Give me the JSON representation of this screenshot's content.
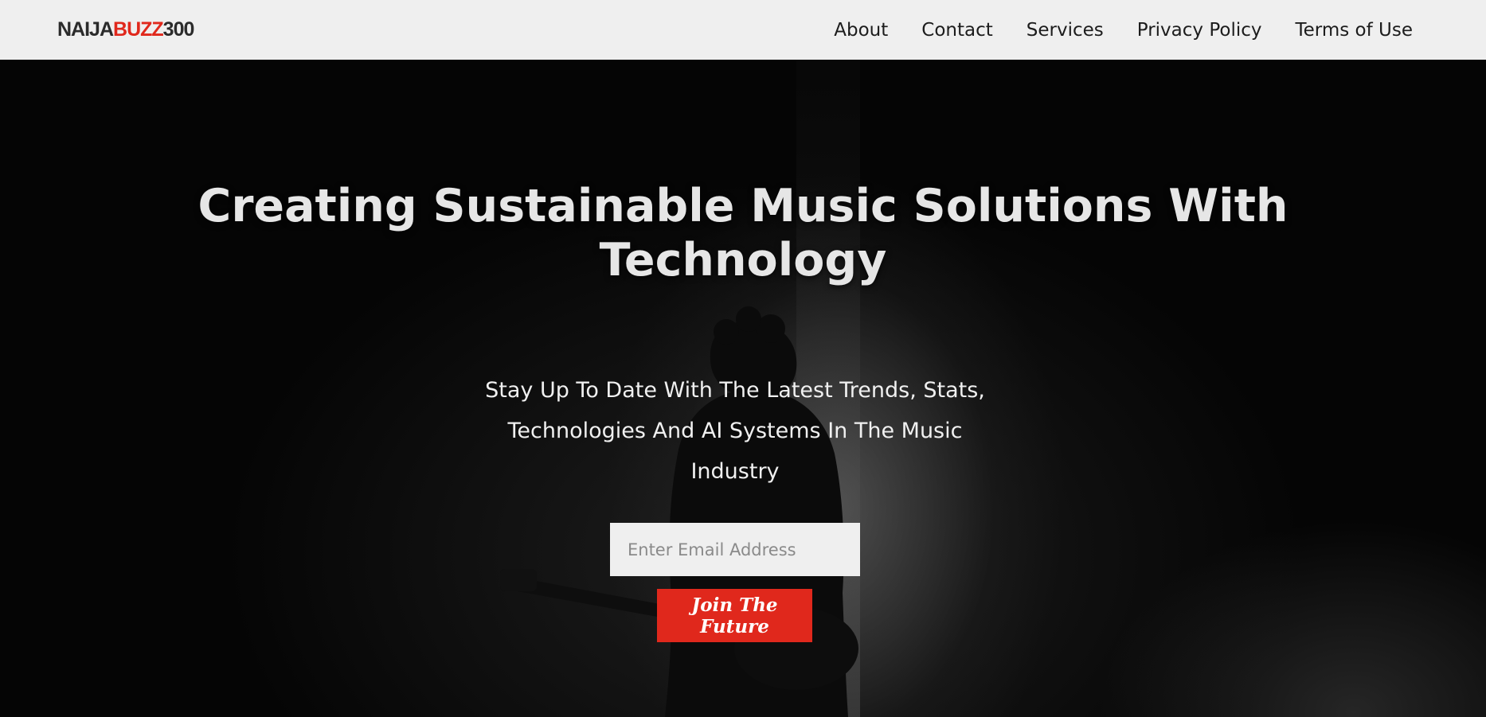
{
  "header": {
    "logo": {
      "part1": "NAIJA",
      "part2": "BUZZ",
      "part3": "300"
    },
    "nav": [
      {
        "label": "About"
      },
      {
        "label": "Contact"
      },
      {
        "label": "Services"
      },
      {
        "label": "Privacy Policy"
      },
      {
        "label": "Terms of Use"
      }
    ]
  },
  "hero": {
    "title": "Creating Sustainable Music Solutions With Technology",
    "subtitle": "Stay Up To Date With The Latest Trends, Stats, Technologies And AI Systems In The Music Industry",
    "email_placeholder": "Enter Email Address",
    "email_value": "",
    "cta_label": "Join The Future"
  },
  "colors": {
    "accent": "#e0281c",
    "header_bg": "#efefef",
    "hero_bg": "#050505",
    "input_bg": "#efefef"
  }
}
